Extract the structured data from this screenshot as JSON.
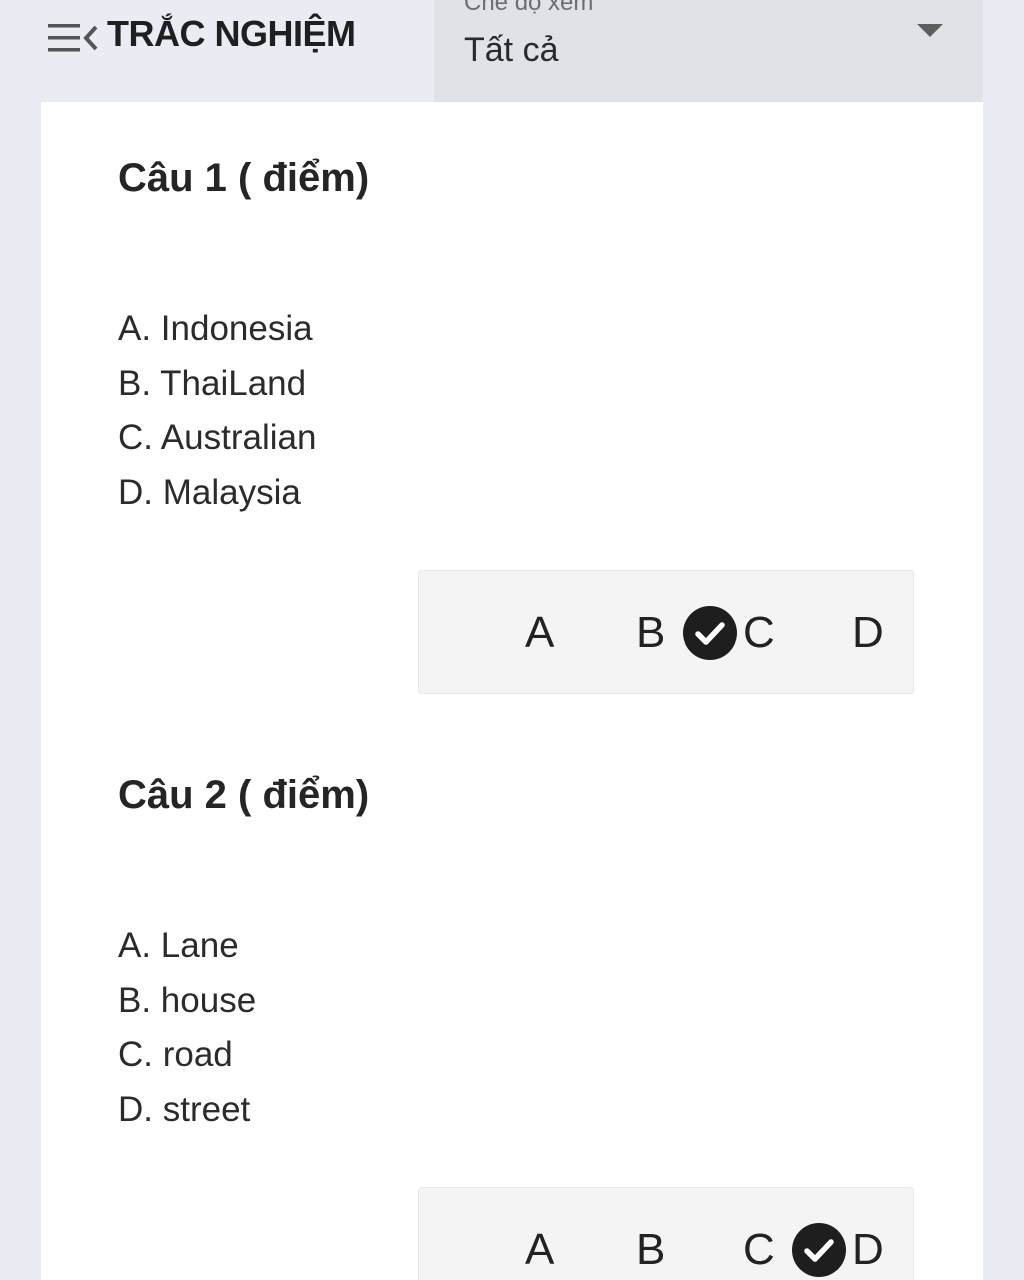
{
  "header": {
    "title": "TRẮC NGHIỆM",
    "view_mode": {
      "label": "Chế độ xem",
      "selected": "Tất cả"
    }
  },
  "questions": [
    {
      "title": "Câu 1 ( điểm)",
      "options": [
        "A. Indonesia",
        "B. ThaiLand",
        "C. Australian",
        "D. Malaysia"
      ],
      "choices": [
        "A",
        "B",
        "C",
        "D"
      ],
      "selected": "C"
    },
    {
      "title": "Câu 2 ( điểm)",
      "options": [
        "A. Lane",
        "B. house",
        "C. road",
        "D. street"
      ],
      "choices": [
        "A",
        "B",
        "C",
        "D"
      ],
      "selected": "D"
    }
  ],
  "icons": {
    "menu": "menu-collapse-icon",
    "dropdown": "chevron-down-icon",
    "selected": "check-circle-icon"
  },
  "colors": {
    "page_background": "#e9ecf2",
    "card_background": "#ffffff",
    "select_background": "#dfe2e6",
    "answer_bar_background": "#f4f4f4",
    "check_icon": "#1e1e1e"
  }
}
